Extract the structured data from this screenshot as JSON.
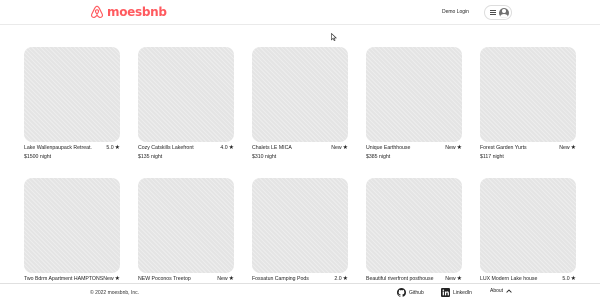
{
  "brand": {
    "name": "moesbnb",
    "color": "#ff5a5f"
  },
  "nav": {
    "login_label": "Demo Login",
    "menu_icon": "hamburger-icon",
    "avatar_icon": "user-avatar-icon"
  },
  "listings": [
    {
      "title": "Lake Wallenpaupack Retreat.",
      "rating": "5.0",
      "price": "$1500 night"
    },
    {
      "title": "Cozy Catskills Lakefront",
      "rating": "4.0",
      "price": "$135 night"
    },
    {
      "title": "Chalets LE MICA",
      "rating": "New",
      "price": "$310 night"
    },
    {
      "title": "Unique Earthhouse",
      "rating": "New",
      "price": "$385 night"
    },
    {
      "title": "Forest Garden Yurts",
      "rating": "New",
      "price": "$117 night"
    },
    {
      "title": "Two Bdrm Apartment HAMPTONS",
      "rating": "New",
      "price": ""
    },
    {
      "title": "NEW Poconos Treetop",
      "rating": "New",
      "price": ""
    },
    {
      "title": "Fossatun Camping Pods",
      "rating": "2.0",
      "price": ""
    },
    {
      "title": "Beautiful riverfront posthouse",
      "rating": "New",
      "price": ""
    },
    {
      "title": "LUX Modern Lake house",
      "rating": "5.0",
      "price": ""
    }
  ],
  "footer": {
    "copyright": "© 2022 moesbnb, Inc.",
    "github_label": "Github",
    "linkedin_label": "LinkedIn",
    "about_label": "About"
  }
}
